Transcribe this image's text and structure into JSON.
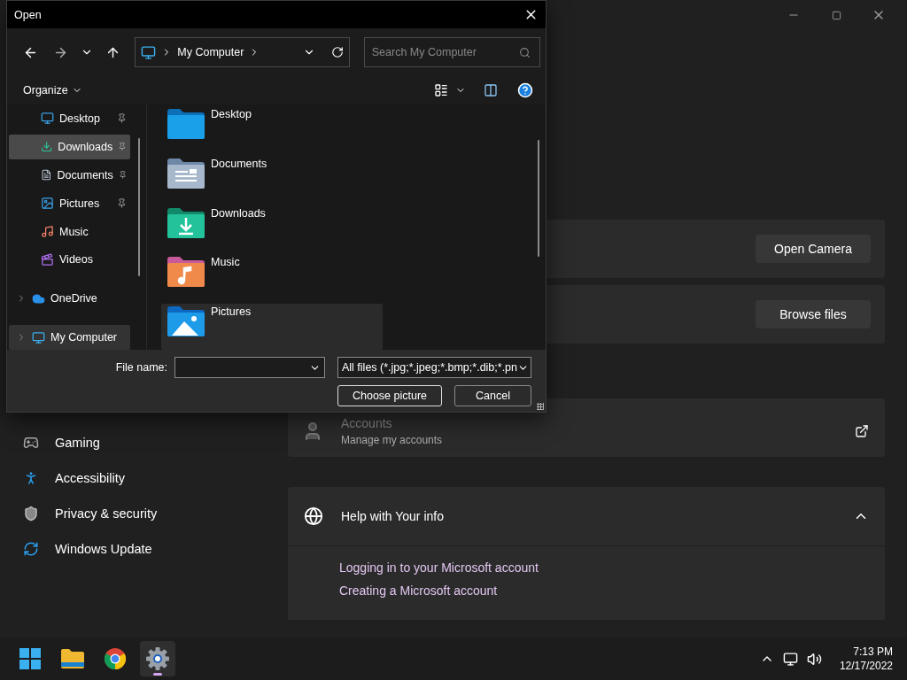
{
  "settings": {
    "sidebar": [
      {
        "label": "Gaming",
        "kind": "gaming"
      },
      {
        "label": "Accessibility",
        "kind": "accessibility"
      },
      {
        "label": "Privacy & security",
        "kind": "privacy"
      },
      {
        "label": "Windows Update",
        "kind": "update"
      }
    ],
    "cards": [
      {
        "kind": "action",
        "button": "Open Camera"
      },
      {
        "kind": "action",
        "button": "Browse files"
      },
      {
        "kind": "link",
        "title": "Accounts",
        "subtitle": "Manage my accounts"
      }
    ],
    "help": {
      "title": "Help with Your info",
      "expanded": true,
      "links": [
        "Logging in to your Microsoft account",
        "Creating a Microsoft account"
      ]
    }
  },
  "dialog": {
    "title": "Open",
    "address": "My Computer",
    "search": {
      "placeholder": "Search My Computer"
    },
    "organize": "Organize",
    "nav_items": [
      {
        "label": "Desktop",
        "kind": "desktop",
        "pinned": true,
        "expandable": false,
        "hovered": false,
        "selected": false
      },
      {
        "label": "Downloads",
        "kind": "downloads",
        "pinned": true,
        "expandable": false,
        "hovered": true,
        "selected": false
      },
      {
        "label": "Documents",
        "kind": "documents",
        "pinned": true,
        "expandable": false,
        "hovered": false,
        "selected": false
      },
      {
        "label": "Pictures",
        "kind": "pictures",
        "pinned": true,
        "expandable": false,
        "hovered": false,
        "selected": false
      },
      {
        "label": "Music",
        "kind": "music",
        "pinned": false,
        "expandable": false,
        "hovered": false,
        "selected": false
      },
      {
        "label": "Videos",
        "kind": "videos",
        "pinned": false,
        "expandable": false,
        "hovered": false,
        "selected": false
      },
      {
        "label": "OneDrive",
        "kind": "cloud",
        "pinned": false,
        "expandable": true,
        "hovered": false,
        "selected": false
      },
      {
        "label": "My Computer",
        "kind": "computer",
        "pinned": false,
        "expandable": true,
        "hovered": false,
        "selected": true
      }
    ],
    "folders": [
      {
        "label": "Desktop",
        "kind": "desktop",
        "selected": false
      },
      {
        "label": "Documents",
        "kind": "documents",
        "selected": false
      },
      {
        "label": "Downloads",
        "kind": "downloads",
        "selected": false
      },
      {
        "label": "Music",
        "kind": "music",
        "selected": false
      },
      {
        "label": "Pictures",
        "kind": "pictures",
        "selected": true
      }
    ],
    "file_name": {
      "label": "File name:"
    },
    "filter": "All files (*.jpg;*.jpeg;*.bmp;*.dib;*.pn",
    "buttons": [
      {
        "label": "Choose picture",
        "default": true
      },
      {
        "label": "Cancel",
        "default": false
      }
    ]
  },
  "taskbar": {
    "apps": [
      {
        "kind": "start",
        "selected": false
      },
      {
        "kind": "explorer",
        "selected": false
      },
      {
        "kind": "browser",
        "selected": false
      },
      {
        "kind": "settings",
        "selected": true
      }
    ],
    "time": "7:13 PM",
    "date": "12/17/2022"
  }
}
